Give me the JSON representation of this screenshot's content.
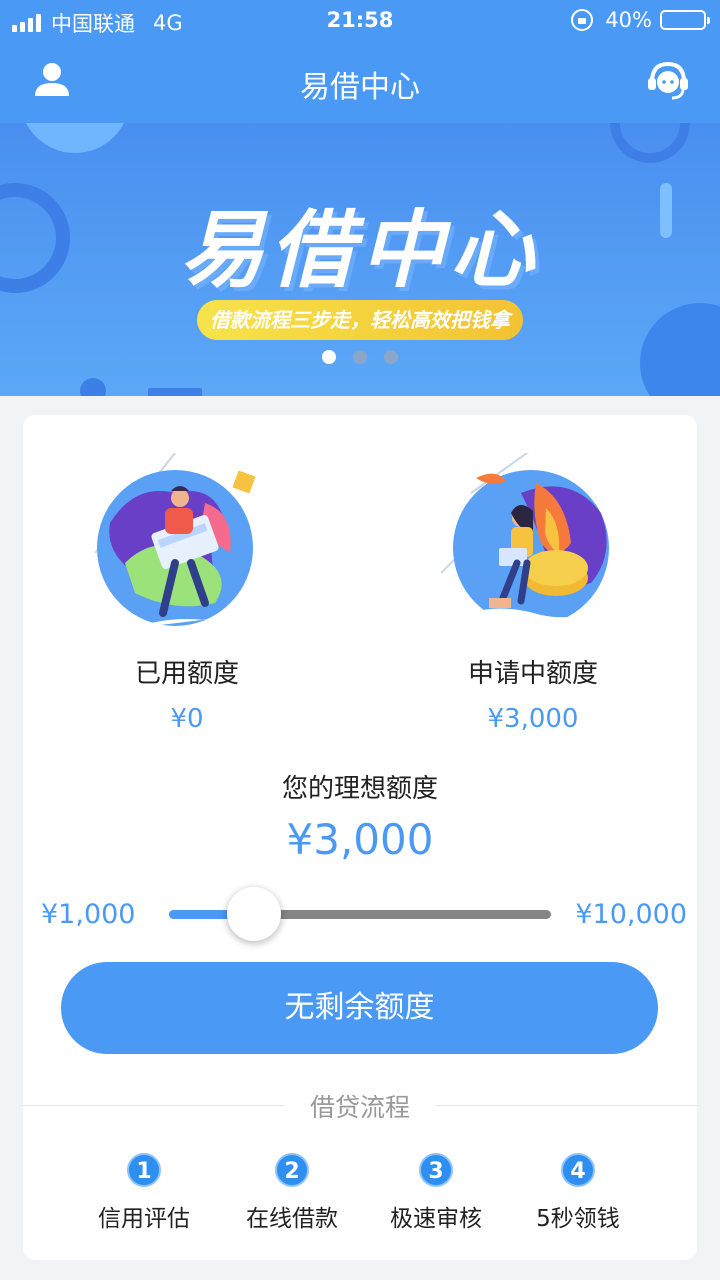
{
  "status_bar": {
    "carrier": "中国联通",
    "network": "4G",
    "time": "21:58",
    "battery": "40%",
    "battery_level": 0.4
  },
  "nav": {
    "title": "易借中心",
    "left_icon": "user-icon",
    "right_icon": "customer-service-icon"
  },
  "banner": {
    "title": "易借中心",
    "slogan": "借款流程三步走，轻松高效把钱拿",
    "slides": 3,
    "active_slide": 0
  },
  "quota": {
    "used": {
      "label": "已用额度",
      "value": "¥0"
    },
    "applying": {
      "label": "申请中额度",
      "value": "¥3,000"
    }
  },
  "ideal": {
    "label": "您的理想额度",
    "value": "¥3,000"
  },
  "slider": {
    "min_label": "¥1,000",
    "max_label": "¥10,000",
    "min": 1000,
    "max": 10000,
    "value": 3000
  },
  "action_button": "无剩余额度",
  "process": {
    "title": "借贷流程",
    "steps": [
      {
        "num": "1",
        "label": "信用评估"
      },
      {
        "num": "2",
        "label": "在线借款"
      },
      {
        "num": "3",
        "label": "极速审核"
      },
      {
        "num": "4",
        "label": "5秒领钱"
      }
    ]
  },
  "colors": {
    "primary": "#4a9af5",
    "step_badge": "#2e8ff0",
    "slogan_bg": "#f3d23f"
  }
}
